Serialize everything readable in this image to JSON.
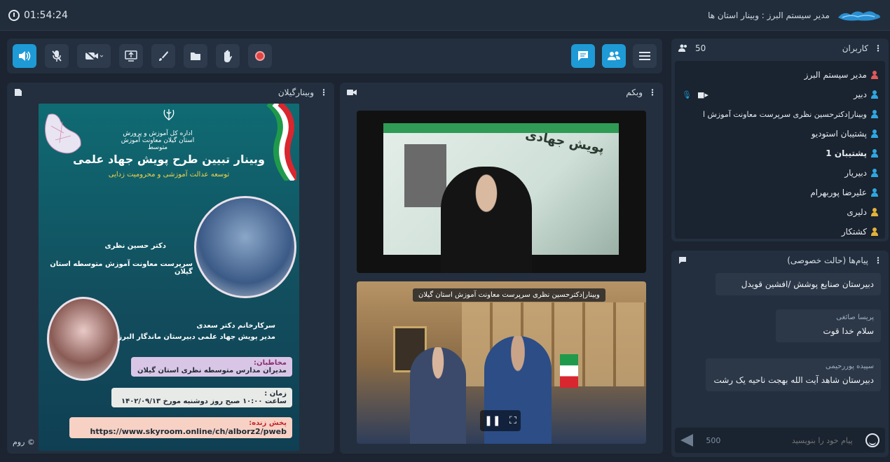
{
  "topbar": {
    "timer": "01:54:24",
    "title": "مدیر سیستم البرز : وبینار استان ها"
  },
  "left_panel": {
    "title": "وبینارگیلان",
    "footer": "روم ©"
  },
  "poster": {
    "org": "اداره کل آموزش و پرورش استان گیلان معاونت آموزش متوسط",
    "title": "وبینار تبیین طرح پویش جهاد علمی",
    "subtitle": "توسعه عدالت آموزشی و محرومیت زدایی",
    "speaker1_name": "دکتر حسین نظری",
    "speaker1_role": "سرپرست معاونت آموزش متوسطه استان گیلان",
    "speaker2_name": "سرکارخانم دکتر سعدی",
    "speaker2_role": "مدیر پویش جهاد علمی دبیرستان ماندگار البرز",
    "audience_label": "مخاطبان:",
    "audience": "مدیران مدارس متوسطه نظری استان گیلان",
    "time_label": "زمان :",
    "time": "ساعت ۱۰:۰۰ صبح روز دوشنبه مورخ ۱۴۰۲/۰۹/۱۳",
    "live_label": "پخش زنده:",
    "live_url": "https://www.skyroom.online/ch/alborz2/pweb"
  },
  "mid_panel": {
    "title": "وبکم",
    "caption": "وبینار|دکترحسین نظری سرپرست معاونت آموزش استان گیلان",
    "slide_text": "پویش جهادی"
  },
  "users": {
    "title": "کاربران",
    "count": "50",
    "list": [
      {
        "name": "مدیر سیستم البرز",
        "color": "#e05a5a",
        "media": ""
      },
      {
        "name": "دبیر",
        "color": "#2fa7e0",
        "media": "mic-cam"
      },
      {
        "name": "وبینار|دکترحسین نظری سرپرست معاونت آموزش ا",
        "color": "#2fa7e0",
        "media": "cam"
      },
      {
        "name": "پشتیبان استودیو",
        "color": "#2fa7e0",
        "media": ""
      },
      {
        "name": "پشتیبان 1",
        "color": "#2fa7e0",
        "media": ""
      },
      {
        "name": "دبیریار",
        "color": "#2fa7e0",
        "media": ""
      },
      {
        "name": "علیرضا پوربهرام",
        "color": "#2fa7e0",
        "media": ""
      },
      {
        "name": "دلیری",
        "color": "#e2b23a",
        "media": ""
      },
      {
        "name": "کشتکار",
        "color": "#e2b23a",
        "media": ""
      }
    ]
  },
  "chat": {
    "title": "پیام‌ها (حالت خصوصی)",
    "messages": [
      {
        "who": "",
        "body": "دبیرستان صنایع پوشش /افشین قویدل"
      },
      {
        "who": "پریسا صائغی",
        "body": "سلام خدا قوت"
      },
      {
        "who": "سپیده پوررحیمی",
        "body": "دبیرستان شاهد آیت الله بهجت ناحیه یک رشت"
      }
    ],
    "placeholder": "پیام خود را بنویسید",
    "char_count": "500"
  },
  "colors": {
    "accent": "#1e9ad6",
    "record": "#e24343"
  }
}
